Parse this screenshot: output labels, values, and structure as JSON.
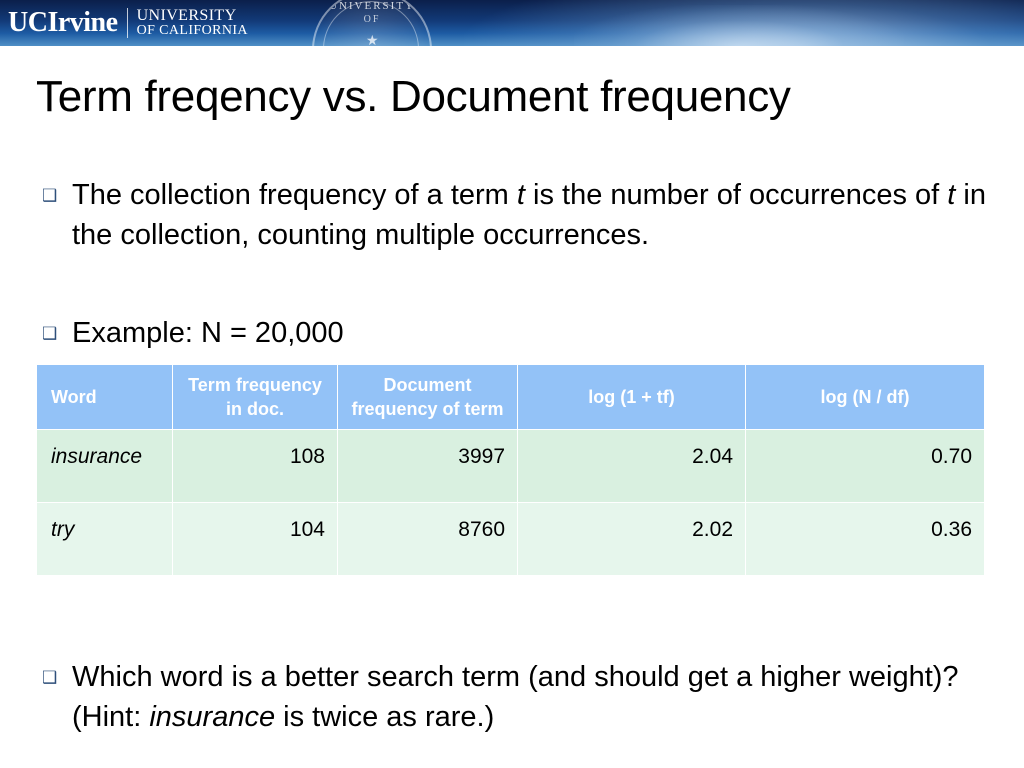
{
  "header": {
    "logo_primary_uc": "UC",
    "logo_primary_irvine": "Irvine",
    "logo_secondary_line1": "UNIVERSITY",
    "logo_secondary_line2": "OF CALIFORNIA",
    "seal_text_top": "UNIVERSITY",
    "seal_text_bottom": "OF",
    "seal_star": "★"
  },
  "title": "Term freqency vs. Document frequency",
  "bullets": {
    "marker": "❑",
    "b1_part1": "The collection frequency of a term ",
    "b1_italic1": "t",
    "b1_part2": " is the number of occurrences of ",
    "b1_italic2": "t",
    "b1_part3": " in the collection, counting multiple occurrences.",
    "b2": "Example: N = 20,000",
    "b3_part1": "Which word is a better search term (and should get a higher weight)? (Hint: ",
    "b3_italic1": "insurance",
    "b3_part2": " is twice as rare.)"
  },
  "table": {
    "headers": [
      "Word",
      "Term frequency in doc.",
      "Document frequency of term",
      "log (1 + tf)",
      "log (N / df)"
    ],
    "rows": [
      {
        "word": "insurance",
        "tf": "108",
        "df": "3997",
        "log_tf": "2.04",
        "log_ndf": "0.70"
      },
      {
        "word": "try",
        "tf": "104",
        "df": "8760",
        "log_tf": "2.02",
        "log_ndf": "0.36"
      }
    ]
  },
  "colors": {
    "header_blue": "#93c2f7",
    "row_a_green": "#d9f0e0",
    "row_b_green": "#e6f6ec",
    "band_dark": "#0b1f4b"
  }
}
